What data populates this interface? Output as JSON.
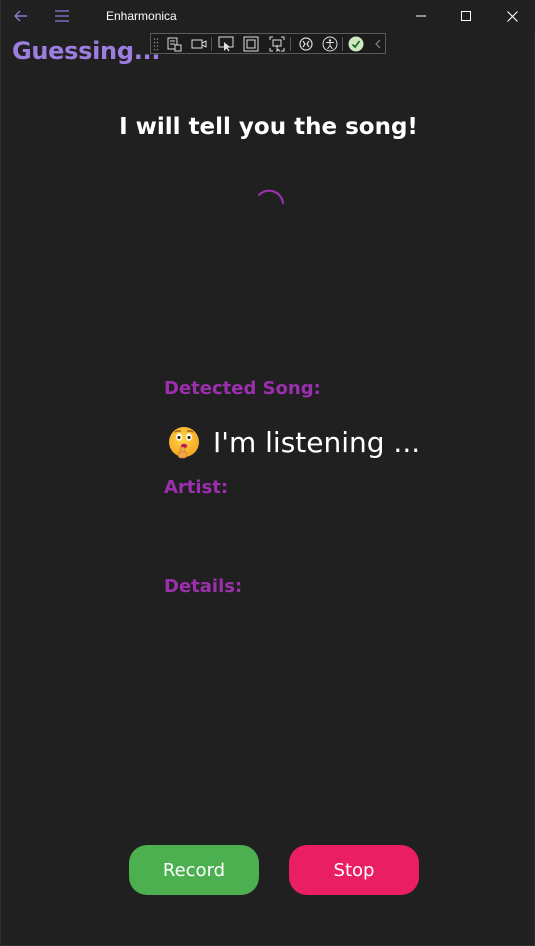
{
  "window": {
    "title": "Enharmonica",
    "back_icon": "back-arrow-icon",
    "menu_icon": "hamburger-menu-icon",
    "controls": [
      "minimize",
      "maximize",
      "close"
    ]
  },
  "page": {
    "heading": "Guessing...",
    "subtitle": "I will tell you the song!",
    "accent_color": "#9c7de0",
    "label_color": "#9b2fae"
  },
  "song": {
    "label": "Detected Song:",
    "value": "I'm listening ...",
    "emoji": "shushing-face-icon"
  },
  "artist": {
    "label": "Artist:",
    "value": ""
  },
  "details": {
    "label": "Details:",
    "value": ""
  },
  "buttons": {
    "record_label": "Record",
    "record_color": "#4caf50",
    "stop_label": "Stop",
    "stop_color": "#e91e63"
  }
}
